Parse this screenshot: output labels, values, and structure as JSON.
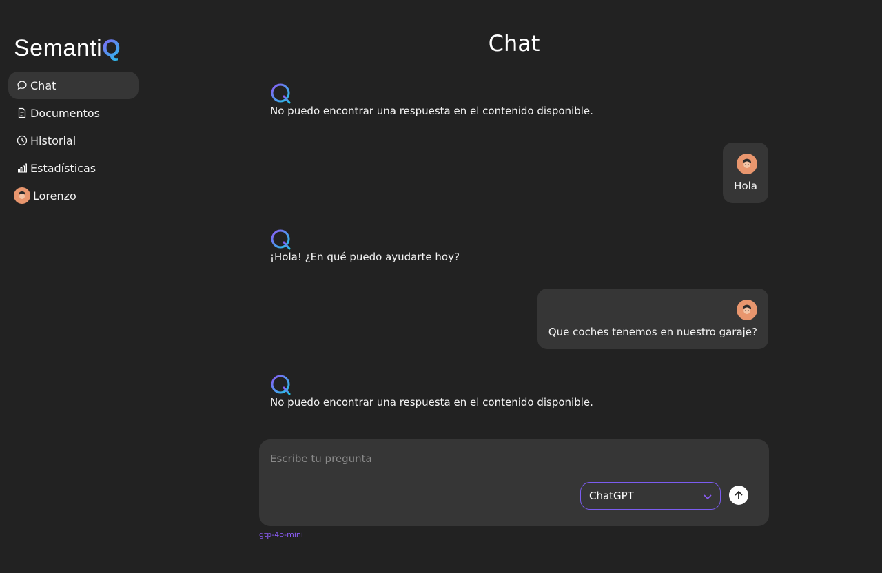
{
  "brand": {
    "name_prefix": "Semanti",
    "name_suffix": "Q"
  },
  "sidebar": {
    "items": [
      {
        "label": "Chat",
        "icon": "chat-bubble-icon",
        "active": true
      },
      {
        "label": "Documentos",
        "icon": "document-icon"
      },
      {
        "label": "Historial",
        "icon": "clock-icon"
      },
      {
        "label": "Estadísticas",
        "icon": "bar-chart-icon"
      },
      {
        "label": "Lorenzo",
        "icon": "user-avatar"
      }
    ]
  },
  "page": {
    "title": "Chat"
  },
  "messages": [
    {
      "role": "assistant",
      "text": "No puedo encontrar una respuesta en el contenido disponible."
    },
    {
      "role": "user",
      "text": "Hola"
    },
    {
      "role": "assistant",
      "text": "¡Hola! ¿En qué puedo ayudarte hoy?"
    },
    {
      "role": "user",
      "text": "Que coches tenemos en nuestro garaje?"
    },
    {
      "role": "assistant",
      "text": "No puedo encontrar una respuesta en el contenido disponible."
    }
  ],
  "composer": {
    "placeholder": "Escribe tu pregunta",
    "model_selected": "ChatGPT",
    "model_sub": "gtp-4o-mini"
  },
  "colors": {
    "background": "#222222",
    "panel": "#363636",
    "accent": "#8b5cf6",
    "accent2": "#22c5e8",
    "avatar": "#e8966e"
  }
}
